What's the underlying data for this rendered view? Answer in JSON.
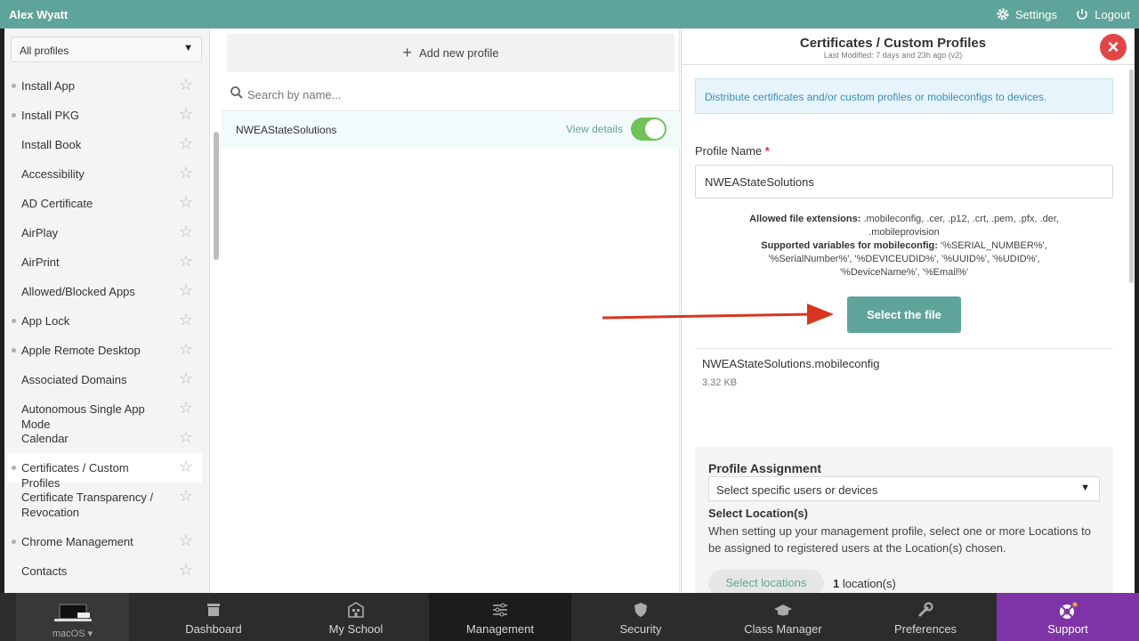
{
  "topbar": {
    "user_name": "Alex Wyatt",
    "settings_label": "Settings",
    "logout_label": "Logout"
  },
  "sidebar": {
    "filter_label": "All profiles",
    "items": [
      {
        "label": "Install App",
        "dot": true
      },
      {
        "label": "Install PKG",
        "dot": true
      },
      {
        "label": "Install Book",
        "dot": false
      },
      {
        "label": "Accessibility",
        "dot": false
      },
      {
        "label": "AD Certificate",
        "dot": false
      },
      {
        "label": "AirPlay",
        "dot": false
      },
      {
        "label": "AirPrint",
        "dot": false
      },
      {
        "label": "Allowed/Blocked Apps",
        "dot": false
      },
      {
        "label": "App Lock",
        "dot": true
      },
      {
        "label": "Apple Remote Desktop",
        "dot": true
      },
      {
        "label": "Associated Domains",
        "dot": false
      },
      {
        "label": "Autonomous Single App Mode",
        "dot": false
      },
      {
        "label": "Calendar",
        "dot": false
      },
      {
        "label": "Certificates / Custom Profiles",
        "dot": true,
        "active": true
      },
      {
        "label": "Certificate Transparency / Revocation",
        "dot": false
      },
      {
        "label": "Chrome Management",
        "dot": true
      },
      {
        "label": "Contacts",
        "dot": false
      }
    ]
  },
  "middle": {
    "add_label": "Add new profile",
    "search_placeholder": "Search by name...",
    "profile_name": "NWEAStateSolutions",
    "view_details": "View details",
    "enabled": true
  },
  "panel": {
    "title": "Certificates / Custom Profiles",
    "subtitle": "Last Modified: 7 days and 23h ago (v2)",
    "info": "Distribute certificates and/or custom profiles or mobileconfigs to devices.",
    "profile_name_label": "Profile Name",
    "required_mark": "*",
    "profile_name_value": "NWEAStateSolutions",
    "allowed_ext_label": "Allowed file extensions:",
    "allowed_ext_value": ".mobileconfig, .cer, .p12, .crt, .pem, .pfx, .der, .mobileprovision",
    "vars_label": "Supported variables for mobileconfig:",
    "vars_value": "'%SERIAL_NUMBER%', '%SerialNumber%', '%DEVICEUDID%', '%UUID%', '%UDID%', '%DeviceName%', '%Email%'",
    "select_file_label": "Select the file",
    "file_name": "NWEAStateSolutions.mobileconfig",
    "file_size": "3.32 KB",
    "assignment_title": "Profile Assignment",
    "assignment_select": "Select specific users or devices",
    "locations_title": "Select Location(s)",
    "locations_desc": "When setting up your management profile, select one or more Locations to be assigned to registered users at the Location(s) chosen.",
    "locations_button": "Select locations",
    "locations_count": "1",
    "locations_suffix": "location(s)"
  },
  "bottomnav": {
    "device_label": "macOS ▾",
    "items": [
      "Dashboard",
      "My School",
      "Management",
      "Security",
      "Class Manager",
      "Preferences",
      "Support"
    ]
  },
  "colors": {
    "accent": "#5fa49a",
    "support": "#7e34a6",
    "close": "#e14646",
    "arrow": "#d8361f",
    "toggle": "#72c25a"
  }
}
